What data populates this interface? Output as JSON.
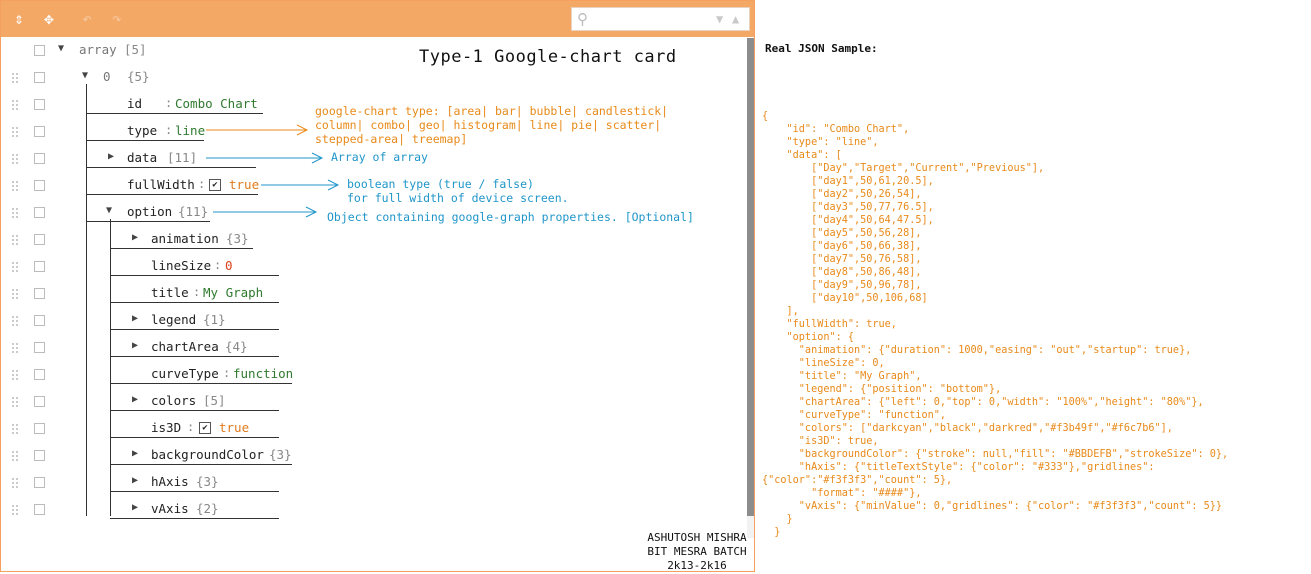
{
  "toolbar": {
    "collapse_all_icon": "collapse-all-icon",
    "expand_all_icon": "expand-all-icon",
    "undo_icon": "undo-icon",
    "redo_icon": "redo-icon",
    "search_placeholder": ""
  },
  "tree_title": "Type-1 Google-chart card",
  "tree": {
    "root_key": "array",
    "root_meta": "[5]",
    "item0_key": "0",
    "item0_meta": "{5}",
    "id_key": "id",
    "id_val": "Combo Chart",
    "type_key": "type",
    "type_val": "line",
    "data_key": "data",
    "data_meta": "[11]",
    "fullwidth_key": "fullWidth",
    "fullwidth_val": "true",
    "option_key": "option",
    "option_meta": "{11}",
    "animation_key": "animation",
    "animation_meta": "{3}",
    "linesize_key": "lineSize",
    "linesize_val": "0",
    "title_key": "title",
    "title_val": "My Graph",
    "legend_key": "legend",
    "legend_meta": "{1}",
    "chartarea_key": "chartArea",
    "chartarea_meta": "{4}",
    "curvetype_key": "curveType",
    "curvetype_val": "function",
    "colors_key": "colors",
    "colors_meta": "[5]",
    "is3d_key": "is3D",
    "is3d_val": "true",
    "bgcolor_key": "backgroundColor",
    "bgcolor_meta": "{3}",
    "haxis_key": "hAxis",
    "haxis_meta": "{3}",
    "vaxis_key": "vAxis",
    "vaxis_meta": "{2}"
  },
  "annotations": {
    "type_note_1": "google-chart type: [area| bar| bubble| candlestick|",
    "type_note_2": "column| combo| geo| histogram| line| pie| scatter|",
    "type_note_3": "stepped-area| treemap]",
    "data_note": "Array of array",
    "fullwidth_note_1": "boolean type (true / false)",
    "fullwidth_note_2": "for full width of device screen.",
    "option_note": "Object containing google-graph properties. [Optional]"
  },
  "credit": {
    "line1": "ASHUTOSH MISHRA",
    "line2": "BIT MESRA BATCH",
    "line3": "2k13-2k16"
  },
  "sample": {
    "title": "Real JSON Sample:",
    "lines": [
      "{",
      "    \"id\": \"Combo Chart\",",
      "    \"type\": \"line\",",
      "    \"data\": [",
      "        [\"Day\",\"Target\",\"Current\",\"Previous\"],",
      "        [\"day1\",50,61,20.5],",
      "        [\"day2\",50,26,54],",
      "        [\"day3\",50,77,76.5],",
      "        [\"day4\",50,64,47.5],",
      "        [\"day5\",50,56,28],",
      "        [\"day6\",50,66,38],",
      "        [\"day7\",50,76,58],",
      "        [\"day8\",50,86,48],",
      "        [\"day9\",50,96,78],",
      "        [\"day10\",50,106,68]",
      "    ],",
      "    \"fullWidth\": true,",
      "    \"option\": {",
      "      \"animation\": {\"duration\": 1000,\"easing\": \"out\",\"startup\": true},",
      "      \"lineSize\": 0,",
      "      \"title\": \"My Graph\",",
      "      \"legend\": {\"position\": \"bottom\"},",
      "      \"chartArea\": {\"left\": 0,\"top\": 0,\"width\": \"100%\",\"height\": \"80%\"},",
      "      \"curveType\": \"function\",",
      "      \"colors\": [\"darkcyan\",\"black\",\"darkred\",\"#f3b49f\",\"#f6c7b6\"],",
      "      \"is3D\": true,",
      "      \"backgroundColor\": {\"stroke\": null,\"fill\": \"#BBDEFB\",\"strokeSize\": 0},",
      "      \"hAxis\": {\"titleTextStyle\": {\"color\": \"#333\"},\"gridlines\":",
      "{\"color\":\"#f3f3f3\",\"count\": 5},",
      "        \"format\": \"####\"},",
      "      \"vAxis\": {\"minValue\": 0,\"gridlines\": {\"color\": \"#f3f3f3\",\"count\": 5}}",
      "    }",
      "  }"
    ]
  },
  "colors": {
    "toolbar": "#f4a866",
    "border": "#f5a05e",
    "annotation_orange": "#e88a1a",
    "annotation_blue": "#2096c9",
    "string_value": "#2f7a2f",
    "number_value": "#d9401f"
  }
}
